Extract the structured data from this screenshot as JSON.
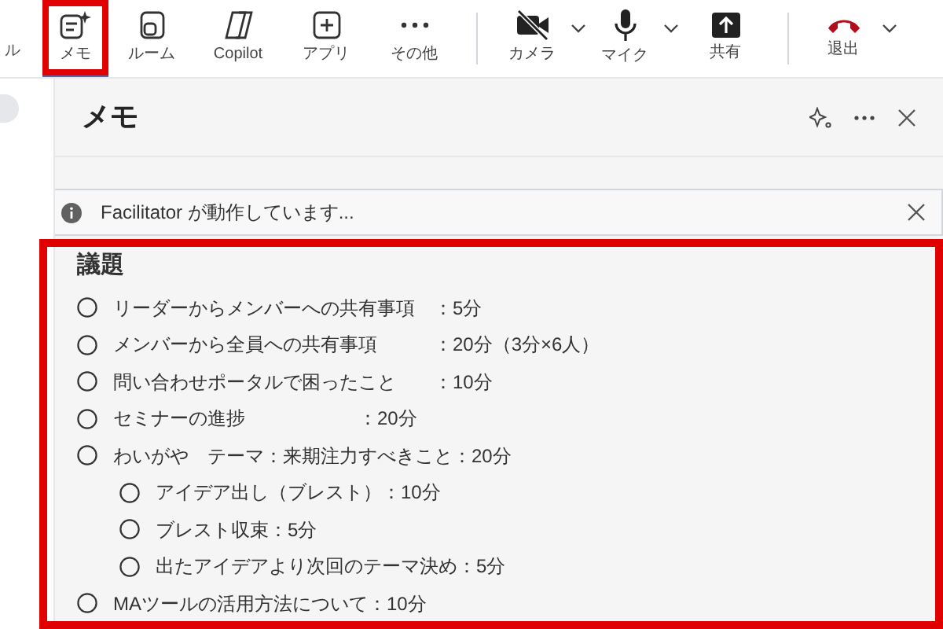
{
  "toolbar": {
    "cut_label": "ル",
    "items": [
      {
        "label": "メモ",
        "kind": "notes",
        "selected": true,
        "dropdown": false
      },
      {
        "label": "ルーム",
        "kind": "room",
        "selected": false,
        "dropdown": false
      },
      {
        "label": "Copilot",
        "kind": "copilot",
        "selected": false,
        "dropdown": false
      },
      {
        "label": "アプリ",
        "kind": "apps",
        "selected": false,
        "dropdown": false
      },
      {
        "label": "その他",
        "kind": "more",
        "selected": false,
        "dropdown": false
      },
      {
        "label": "カメラ",
        "kind": "camera",
        "selected": false,
        "dropdown": true
      },
      {
        "label": "マイク",
        "kind": "mic",
        "selected": false,
        "dropdown": true
      },
      {
        "label": "共有",
        "kind": "share",
        "selected": false,
        "dropdown": false
      },
      {
        "label": "退出",
        "kind": "leave",
        "selected": false,
        "dropdown": true
      }
    ]
  },
  "panel": {
    "title": "メモ",
    "banner": {
      "text": "Facilitator が動作しています..."
    },
    "agenda": {
      "heading": "議題",
      "items": [
        {
          "text": "リーダーからメンバーへの共有事項　：5分"
        },
        {
          "text": "メンバーから全員への共有事項　　　：20分（3分×6人）"
        },
        {
          "text": "問い合わせポータルで困ったこと　　：10分"
        },
        {
          "text": "セミナーの進捗　　　　　　：20分"
        },
        {
          "text": "わいがや　テーマ：来期注力すべきこと：20分",
          "children": [
            {
              "text": "アイデア出し（ブレスト）：10分"
            },
            {
              "text": "ブレスト収束：5分"
            },
            {
              "text": "出たアイデアより次回のテーマ決め：5分"
            }
          ]
        },
        {
          "text": "MAツールの活用方法について：10分"
        }
      ]
    }
  }
}
